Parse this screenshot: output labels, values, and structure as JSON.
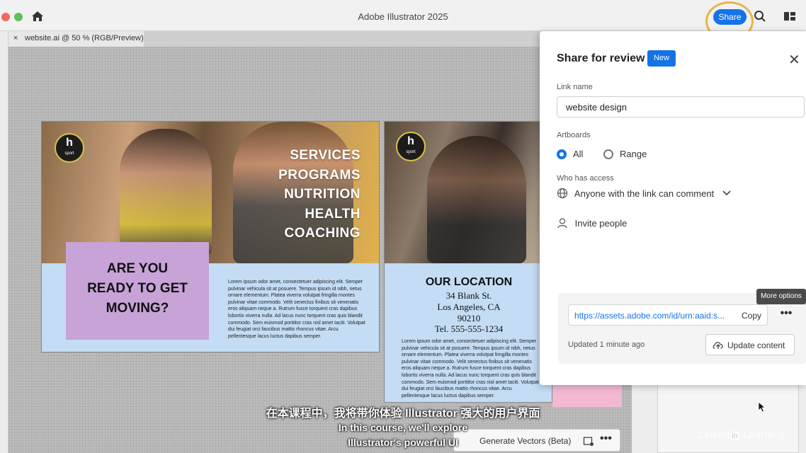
{
  "window": {
    "app_title": "Adobe Illustrator 2025",
    "share_label": "Share"
  },
  "document": {
    "tab_label": "website.ai @ 50 % (RGB/Preview)",
    "close_glyph": "×"
  },
  "artboard1": {
    "logo_mark": "h",
    "logo_sub": "sport",
    "services": [
      "SERVICES",
      "PROGRAMS",
      "NUTRITION",
      "HEALTH",
      "COACHING"
    ],
    "headline": [
      "ARE YOU",
      "READY TO GET",
      "MOVING?"
    ],
    "body": "Lorem ipsum odor amet, consectetuer adipiscing elit. Semper pulvinar vehicula sit at posuere. Tempus ipsum id nibh, netus ornare elementum. Platea viverra volutpat fringilla montes pulvinar vitae commodo. Velit senectus finibus sit venenatis eros aliquam neque a. Rutrum fusce torquent cras dapibus lobortis viverra nulla. Ad lacus nunc torquent cras quis blandit commodo. Sem euismod porttitor cras nisl amet taciti. Volutpat dui feugiat orci faucibus mattis rhoncus vitae. Arcu pellentesque lacus luctus dapibus semper."
  },
  "artboard2": {
    "logo_mark": "h",
    "logo_sub": "sport",
    "title": "OUR LOCATION",
    "address": [
      "34 Blank St.",
      "Los Angeles, CA",
      "90210",
      "Tel. 555-555-1234"
    ],
    "body": "Lorem ipsum odor amet, consectetuer adipiscing elit. Semper pulvinar vehicula sit at posuere. Tempus ipsum id nibh, netus ornare elementum. Platea viverra volutpat fringilla montes pulvinar vitae commodo. Velit senectus finibus sit venenatis eros aliquam neque a. Rutrum fusce torquent cras dapibus lobortis viverra nulla. Ad lacus nunc torquent cras quis blandit commodo. Sem euismod porttitor cras nisl amet taciti. Volutpat dui feugiat orci faucibus mattis rhoncus vitae. Arcu pellentesque lacus luctus dapibus semper."
  },
  "share_panel": {
    "title": "Share for review",
    "badge": "New",
    "close_glyph": "✕",
    "link_name_label": "Link name",
    "link_name_value": "website design",
    "artboards_label": "Artboards",
    "radio_all": "All",
    "radio_range": "Range",
    "selected_artboards": "All",
    "access_label": "Who has access",
    "access_value": "Anyone with the link can comment",
    "invite_label": "Invite people",
    "url": "https://assets.adobe.com/id/urn:aaid:s...",
    "copy_label": "Copy",
    "more_glyph": "•••",
    "tooltip": "More options",
    "updated": "Updated 1 minute ago",
    "update_label": "Update content"
  },
  "context_bar": {
    "generate_label": "Generate Vectors (Beta)",
    "more_glyph": "•••"
  },
  "subtitles": {
    "cn": "在本课程中，我将带你体验 Illustrator 强大的用户界面",
    "en1": "In this course, we'll explore",
    "en2": "Illustrator's powerful UI"
  },
  "watermark": {
    "brand_left": "Linked",
    "brand_in": "in",
    "brand_right": "Learning"
  },
  "colors": {
    "accent": "#1473e6",
    "share_highlight": "#e2b64a",
    "artboard_bg": "#c4dcf4",
    "headline_box": "#c7a3d8"
  }
}
